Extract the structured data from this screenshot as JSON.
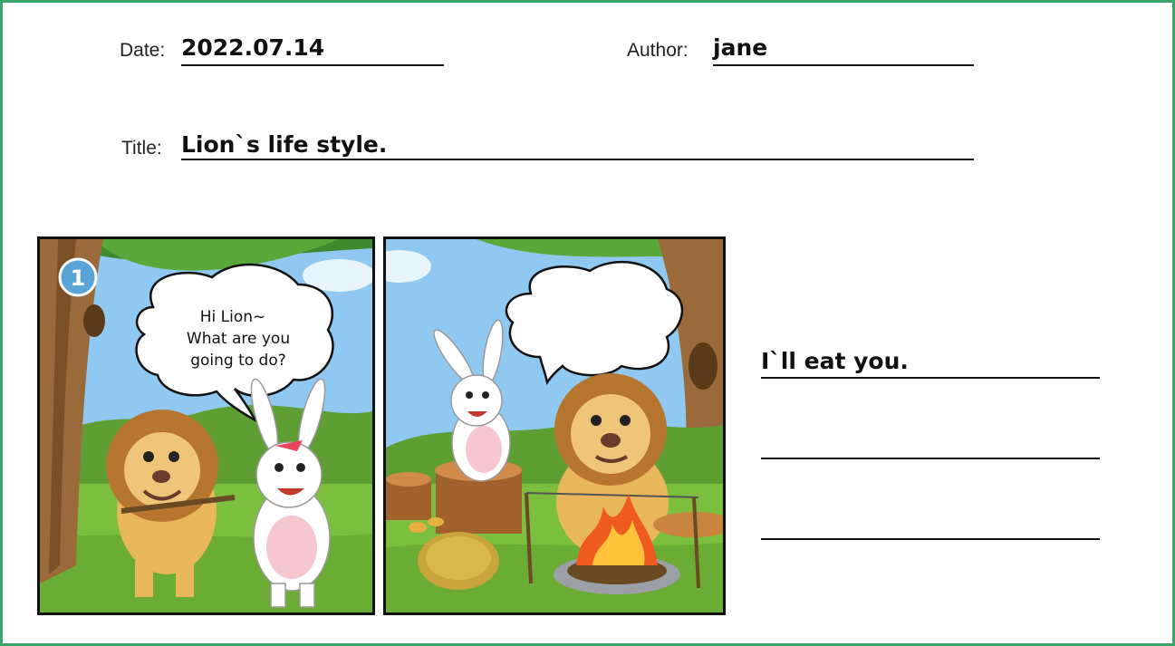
{
  "header": {
    "date_label": "Date:",
    "date_value": "2022.07.14",
    "author_label": "Author:",
    "author_value": "jane",
    "title_label": "Title:",
    "title_value": "Lion`s life style."
  },
  "comic": {
    "panel1": {
      "badge_number": "1",
      "bubble_lines": [
        "Hi Lion~",
        "What are you",
        "going to do?"
      ]
    },
    "panel2": {
      "bubble_text": ""
    }
  },
  "answers": {
    "line1": "I`ll eat you.",
    "line2": "",
    "line3": ""
  },
  "colors": {
    "frame_border": "#3aa56a",
    "badge": "#5aa3d6",
    "sky": "#8fc8f0",
    "grass": "#7cbf3e",
    "tree_trunk": "#9a6a3a",
    "lion_mane": "#b7762f",
    "fire": "#ef5a1f"
  }
}
